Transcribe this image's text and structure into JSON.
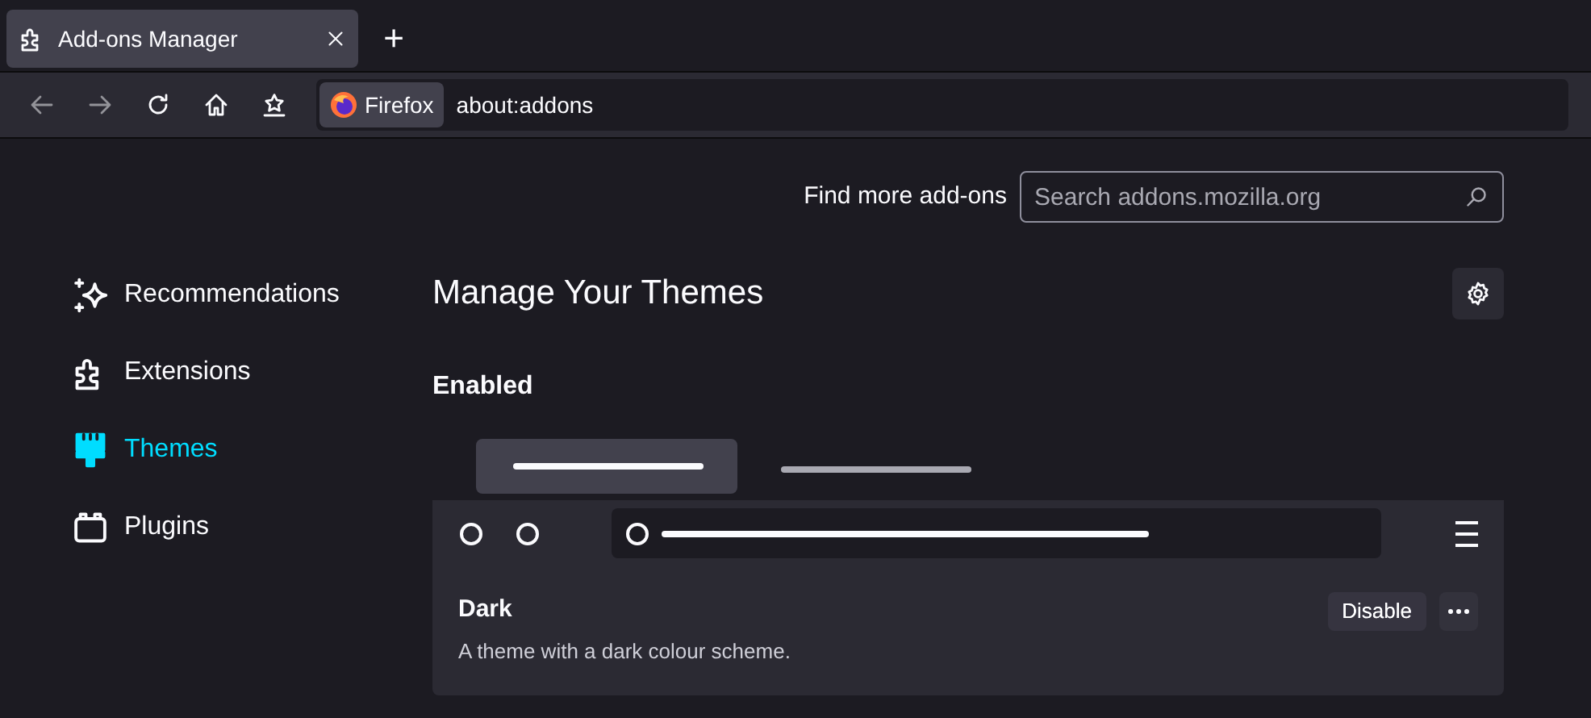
{
  "tabs": [
    {
      "label": "Add-ons Manager",
      "selected": true
    }
  ],
  "new_tab": "+",
  "identity": "Firefox",
  "url": "about:addons",
  "find_label": "Find more add-ons",
  "search": {
    "placeholder": "Search addons.mozilla.org"
  },
  "sidebar": {
    "items": [
      {
        "label": "Recommendations",
        "kind": "sparkle",
        "selected": false
      },
      {
        "label": "Extensions",
        "kind": "puzzle",
        "selected": false
      },
      {
        "label": "Themes",
        "kind": "brush",
        "selected": true
      },
      {
        "label": "Plugins",
        "kind": "plugin",
        "selected": false
      }
    ]
  },
  "heading": "Manage Your Themes",
  "section": "Enabled",
  "themes": [
    {
      "name": "Dark",
      "description": "A theme with a dark colour scheme.",
      "action": "Disable"
    }
  ]
}
